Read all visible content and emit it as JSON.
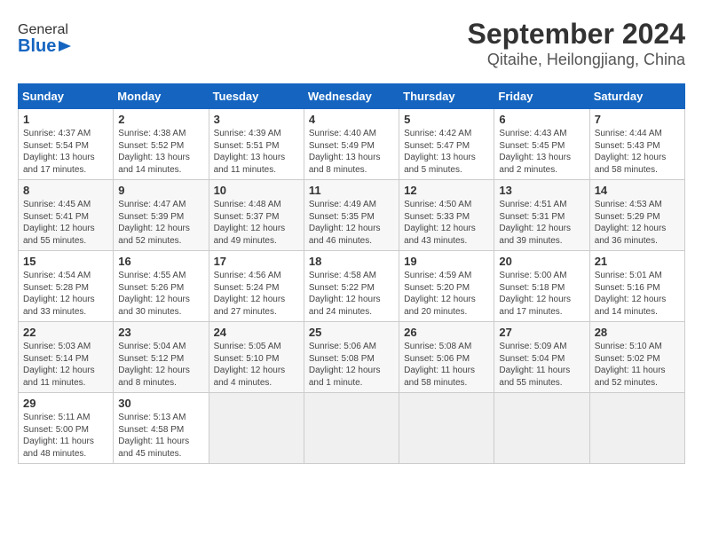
{
  "header": {
    "logo": {
      "line1": "General",
      "line2": "Blue"
    },
    "title": "September 2024",
    "subtitle": "Qitaihe, Heilongjiang, China"
  },
  "calendar": {
    "days_of_week": [
      "Sunday",
      "Monday",
      "Tuesday",
      "Wednesday",
      "Thursday",
      "Friday",
      "Saturday"
    ],
    "weeks": [
      [
        {
          "day": "",
          "empty": true
        },
        {
          "day": "",
          "empty": true
        },
        {
          "day": "",
          "empty": true
        },
        {
          "day": "",
          "empty": true
        },
        {
          "day": "",
          "empty": true
        },
        {
          "day": "",
          "empty": true
        },
        {
          "day": "7",
          "sunrise": "4:44 AM",
          "sunset": "5:43 PM",
          "daylight": "12 hours and 58 minutes."
        }
      ],
      [
        {
          "day": "1",
          "sunrise": "4:37 AM",
          "sunset": "5:54 PM",
          "daylight": "13 hours and 17 minutes."
        },
        {
          "day": "2",
          "sunrise": "4:38 AM",
          "sunset": "5:52 PM",
          "daylight": "13 hours and 14 minutes."
        },
        {
          "day": "3",
          "sunrise": "4:39 AM",
          "sunset": "5:51 PM",
          "daylight": "13 hours and 11 minutes."
        },
        {
          "day": "4",
          "sunrise": "4:40 AM",
          "sunset": "5:49 PM",
          "daylight": "13 hours and 8 minutes."
        },
        {
          "day": "5",
          "sunrise": "4:42 AM",
          "sunset": "5:47 PM",
          "daylight": "13 hours and 5 minutes."
        },
        {
          "day": "6",
          "sunrise": "4:43 AM",
          "sunset": "5:45 PM",
          "daylight": "13 hours and 2 minutes."
        },
        {
          "day": "7",
          "sunrise": "4:44 AM",
          "sunset": "5:43 PM",
          "daylight": "12 hours and 58 minutes."
        }
      ],
      [
        {
          "day": "8",
          "sunrise": "4:45 AM",
          "sunset": "5:41 PM",
          "daylight": "12 hours and 55 minutes."
        },
        {
          "day": "9",
          "sunrise": "4:47 AM",
          "sunset": "5:39 PM",
          "daylight": "12 hours and 52 minutes."
        },
        {
          "day": "10",
          "sunrise": "4:48 AM",
          "sunset": "5:37 PM",
          "daylight": "12 hours and 49 minutes."
        },
        {
          "day": "11",
          "sunrise": "4:49 AM",
          "sunset": "5:35 PM",
          "daylight": "12 hours and 46 minutes."
        },
        {
          "day": "12",
          "sunrise": "4:50 AM",
          "sunset": "5:33 PM",
          "daylight": "12 hours and 43 minutes."
        },
        {
          "day": "13",
          "sunrise": "4:51 AM",
          "sunset": "5:31 PM",
          "daylight": "12 hours and 39 minutes."
        },
        {
          "day": "14",
          "sunrise": "4:53 AM",
          "sunset": "5:29 PM",
          "daylight": "12 hours and 36 minutes."
        }
      ],
      [
        {
          "day": "15",
          "sunrise": "4:54 AM",
          "sunset": "5:28 PM",
          "daylight": "12 hours and 33 minutes."
        },
        {
          "day": "16",
          "sunrise": "4:55 AM",
          "sunset": "5:26 PM",
          "daylight": "12 hours and 30 minutes."
        },
        {
          "day": "17",
          "sunrise": "4:56 AM",
          "sunset": "5:24 PM",
          "daylight": "12 hours and 27 minutes."
        },
        {
          "day": "18",
          "sunrise": "4:58 AM",
          "sunset": "5:22 PM",
          "daylight": "12 hours and 24 minutes."
        },
        {
          "day": "19",
          "sunrise": "4:59 AM",
          "sunset": "5:20 PM",
          "daylight": "12 hours and 20 minutes."
        },
        {
          "day": "20",
          "sunrise": "5:00 AM",
          "sunset": "5:18 PM",
          "daylight": "12 hours and 17 minutes."
        },
        {
          "day": "21",
          "sunrise": "5:01 AM",
          "sunset": "5:16 PM",
          "daylight": "12 hours and 14 minutes."
        }
      ],
      [
        {
          "day": "22",
          "sunrise": "5:03 AM",
          "sunset": "5:14 PM",
          "daylight": "12 hours and 11 minutes."
        },
        {
          "day": "23",
          "sunrise": "5:04 AM",
          "sunset": "5:12 PM",
          "daylight": "12 hours and 8 minutes."
        },
        {
          "day": "24",
          "sunrise": "5:05 AM",
          "sunset": "5:10 PM",
          "daylight": "12 hours and 4 minutes."
        },
        {
          "day": "25",
          "sunrise": "5:06 AM",
          "sunset": "5:08 PM",
          "daylight": "12 hours and 1 minute."
        },
        {
          "day": "26",
          "sunrise": "5:08 AM",
          "sunset": "5:06 PM",
          "daylight": "11 hours and 58 minutes."
        },
        {
          "day": "27",
          "sunrise": "5:09 AM",
          "sunset": "5:04 PM",
          "daylight": "11 hours and 55 minutes."
        },
        {
          "day": "28",
          "sunrise": "5:10 AM",
          "sunset": "5:02 PM",
          "daylight": "11 hours and 52 minutes."
        }
      ],
      [
        {
          "day": "29",
          "sunrise": "5:11 AM",
          "sunset": "5:00 PM",
          "daylight": "11 hours and 48 minutes."
        },
        {
          "day": "30",
          "sunrise": "5:13 AM",
          "sunset": "4:58 PM",
          "daylight": "11 hours and 45 minutes."
        },
        {
          "day": "",
          "empty": true
        },
        {
          "day": "",
          "empty": true
        },
        {
          "day": "",
          "empty": true
        },
        {
          "day": "",
          "empty": true
        },
        {
          "day": "",
          "empty": true
        }
      ]
    ]
  }
}
